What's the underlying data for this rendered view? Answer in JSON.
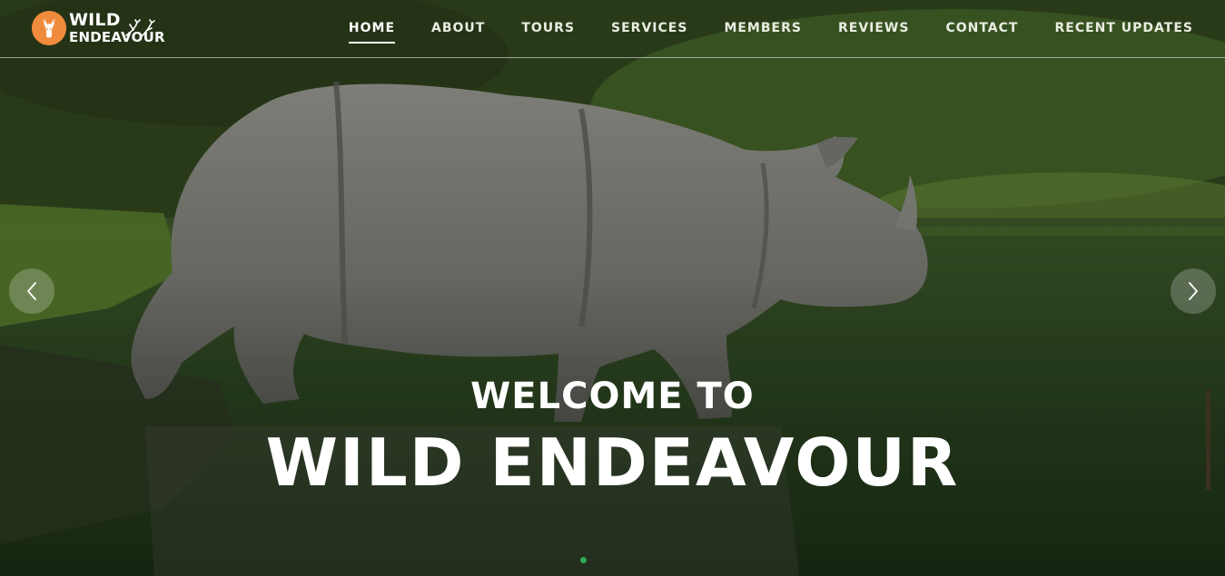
{
  "brand": {
    "line1": "WILD",
    "line2": "ENDEAVOUR",
    "logo_icon": "deer-head-icon",
    "logo_color": "#f08a3c"
  },
  "nav": {
    "items": [
      {
        "label": "HOME",
        "active": true
      },
      {
        "label": "ABOUT",
        "active": false
      },
      {
        "label": "TOURS",
        "active": false
      },
      {
        "label": "SERVICES",
        "active": false
      },
      {
        "label": "MEMBERS",
        "active": false
      },
      {
        "label": "REVIEWS",
        "active": false
      },
      {
        "label": "CONTACT",
        "active": false
      },
      {
        "label": "RECENT UPDATES",
        "active": false
      }
    ]
  },
  "hero": {
    "welcome": "WELCOME TO",
    "title": "WILD ENDEAVOUR",
    "prev_icon": "chevron-left-icon",
    "next_icon": "chevron-right-icon",
    "indicator_color": "#2eaa52"
  }
}
